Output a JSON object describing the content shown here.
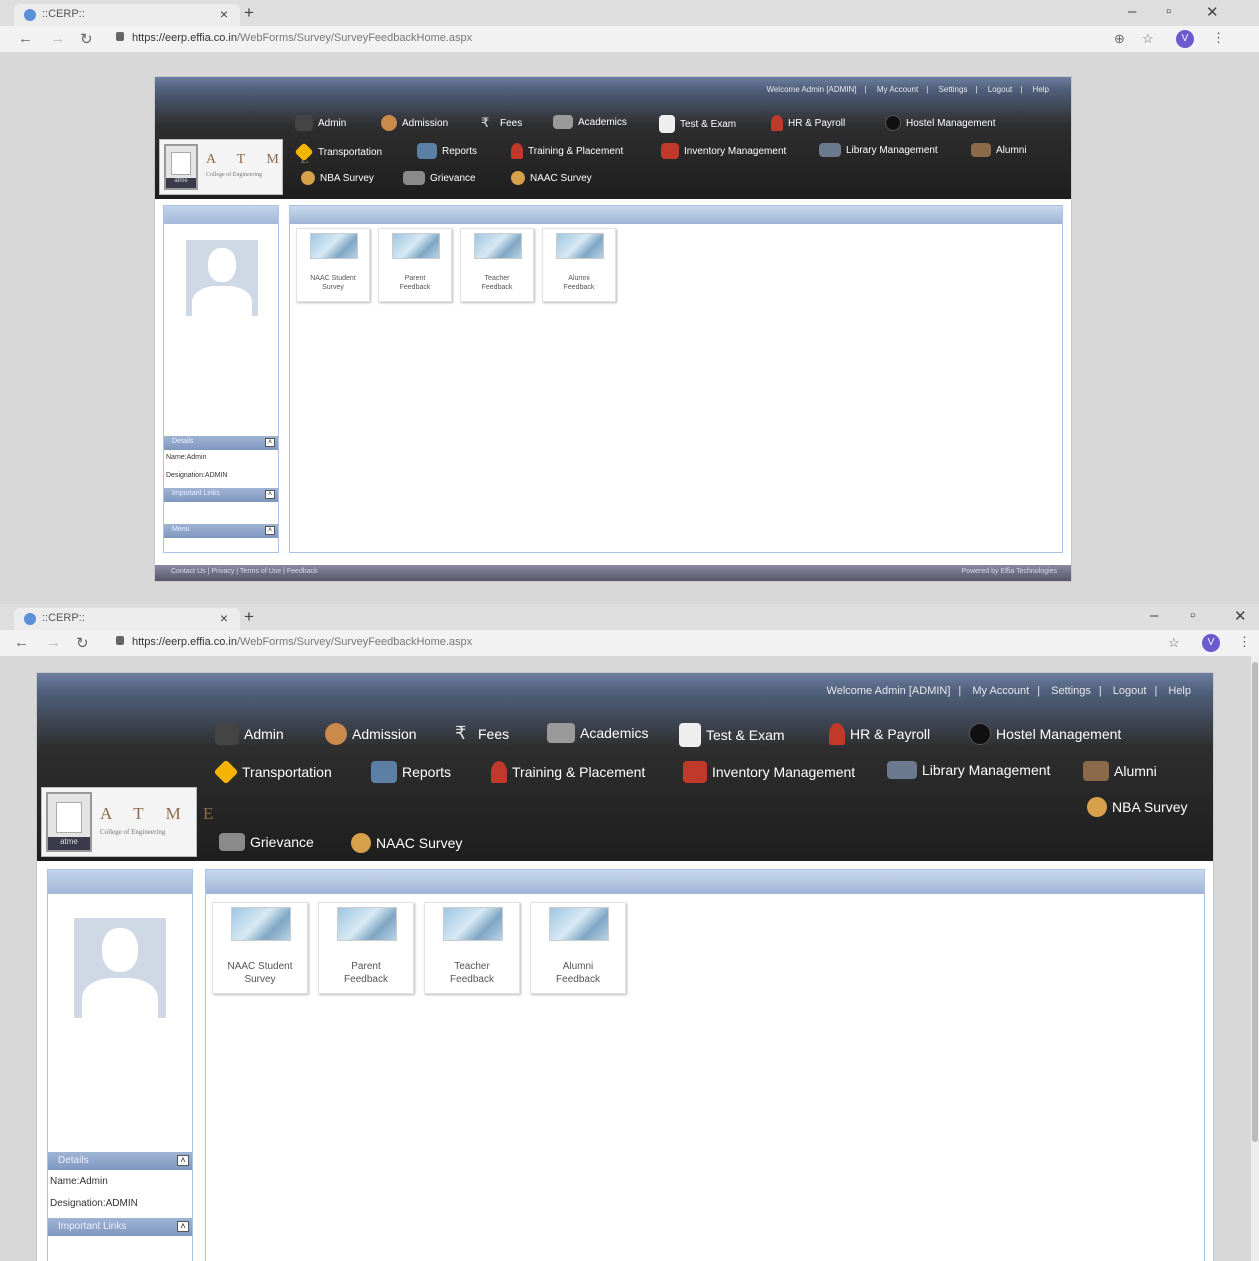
{
  "browser": {
    "tab_title": "::CERP::",
    "tab_close": "×",
    "new_tab": "+",
    "url_domain": "https://eerp.effia.co.in",
    "url_path": "/WebForms/Survey/SurveyFeedbackHome.aspx",
    "profile_initial": "V"
  },
  "header": {
    "top_links": [
      "Welcome Admin [ADMIN]",
      "My Account",
      "Settings",
      "Logout",
      "Help"
    ],
    "separator": "|"
  },
  "logo": {
    "letters": "A T M E",
    "college": "College of Engineering",
    "mark_text": "atme"
  },
  "menu": {
    "admin": "Admin",
    "admission": "Admission",
    "fees": "Fees",
    "academics": "Academics",
    "test_exam": "Test & Exam",
    "hr_payroll": "HR & Payroll",
    "hostel": "Hostel Management",
    "transportation": "Transportation",
    "reports": "Reports",
    "training": "Training & Placement",
    "inventory": "Inventory Management",
    "library": "Library Management",
    "alumni": "Alumni",
    "nba": "NBA Survey",
    "grievance": "Grievance",
    "naac": "NAAC Survey"
  },
  "sidebar": {
    "details_title": "Details",
    "name": "Name:Admin",
    "designation": "Designation:ADMIN",
    "important_links_title": "Important Links",
    "menu_title": "Menu"
  },
  "tiles": [
    {
      "line1": "NAAC Student",
      "line2": "Survey"
    },
    {
      "line1": "Parent",
      "line2": "Feedback"
    },
    {
      "line1": "Teacher",
      "line2": "Feedback"
    },
    {
      "line1": "Alumni",
      "line2": "Feedback"
    }
  ],
  "footer": {
    "left_links": [
      "Contact Us",
      "Privacy",
      "Terms of Use",
      "Feedback"
    ],
    "powered_by": "Powered by Effia Technologies"
  },
  "colors": {
    "header_dark": "#1e1e1e",
    "panel_border": "#a9c4e4",
    "panel_head": "#a3b9d9"
  }
}
